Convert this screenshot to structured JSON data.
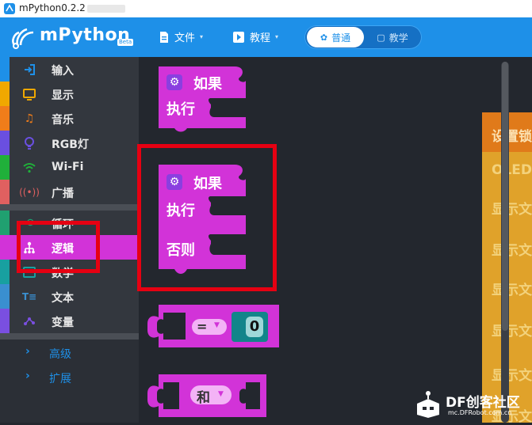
{
  "window": {
    "title": "mPython0.2.2"
  },
  "header": {
    "brand": "mPython",
    "beta": "Beta",
    "file_menu": "文件",
    "tutorial_menu": "教程",
    "mode": {
      "normal": "普通",
      "teach": "教学",
      "selected": "普通"
    }
  },
  "sidebar": {
    "categories": [
      {
        "label": "输入",
        "icon": "input-icon",
        "color": "#1e90e8"
      },
      {
        "label": "显示",
        "icon": "display-icon",
        "color": "#f0a800"
      },
      {
        "label": "音乐",
        "icon": "music-icon",
        "color": "#f07d1a"
      },
      {
        "label": "RGB灯",
        "icon": "bulb-icon",
        "color": "#6a4fe0"
      },
      {
        "label": "Wi-Fi",
        "icon": "wifi-icon",
        "color": "#20b03a"
      },
      {
        "label": "广播",
        "icon": "broadcast-icon",
        "color": "#e06060"
      },
      {
        "label": "循环",
        "icon": "loop-icon",
        "color": "#20a070"
      },
      {
        "label": "逻辑",
        "icon": "logic-icon",
        "color": "#d233d8",
        "active": true
      },
      {
        "label": "数学",
        "icon": "math-icon",
        "color": "#18a0a0"
      },
      {
        "label": "文本",
        "icon": "text-icon",
        "color": "#3a8fd0"
      },
      {
        "label": "变量",
        "icon": "variable-icon",
        "color": "#7a4fe0"
      }
    ],
    "advanced": "高级",
    "extensions": "扩展"
  },
  "workspace": {
    "if_block": {
      "if": "如果",
      "do": "执行"
    },
    "if_else_block": {
      "if": "如果",
      "do": "执行",
      "else": "否则"
    },
    "compare_block": {
      "operator": "=",
      "value": "0"
    },
    "logic_block": {
      "operator": "和"
    },
    "right_blocks": [
      "设置锁",
      "OLED",
      "显示文",
      "显示文",
      "显示文",
      "显示文",
      "显示文",
      "显示文"
    ],
    "block_color": "#d233d8"
  },
  "watermark": {
    "brand": "DF创客社区",
    "url": "mc.DFRobot.com.cn"
  }
}
